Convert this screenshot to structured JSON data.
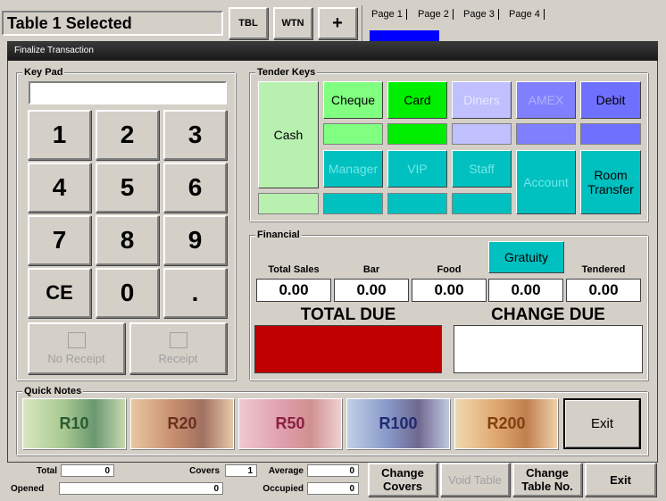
{
  "header": {
    "table_title": "Table 1 Selected",
    "tbl_label": "TBL",
    "wtn_label": "WTN",
    "plus_label": "+",
    "pages": [
      "Page 1",
      "Page 2",
      "Page 3",
      "Page 4"
    ]
  },
  "dialog": {
    "title": "Finalize Transaction"
  },
  "keypad": {
    "label": "Key Pad",
    "display": "",
    "keys": [
      "1",
      "2",
      "3",
      "4",
      "5",
      "6",
      "7",
      "8",
      "9",
      "CE",
      "0",
      "."
    ],
    "no_receipt": "No Receipt",
    "receipt": "Receipt"
  },
  "tender": {
    "label": "Tender Keys",
    "cash": "Cash",
    "cheque": "Cheque",
    "card": "Card",
    "diners": "Diners",
    "amex": "AMEX",
    "debit": "Debit",
    "manager": "Manager",
    "vip": "VIP",
    "staff": "Staff",
    "account": "Account",
    "room_transfer": "Room Transfer"
  },
  "financial": {
    "label": "Financial",
    "gratuity": "Gratuity",
    "total_sales_label": "Total Sales",
    "total_sales": "0.00",
    "bar_label": "Bar",
    "bar": "0.00",
    "food_label": "Food",
    "food": "0.00",
    "gratuity_value": "0.00",
    "tendered_label": "Tendered",
    "tendered": "0.00",
    "total_due_label": "TOTAL DUE",
    "change_due_label": "CHANGE DUE"
  },
  "quick_notes": {
    "label": "Quick Notes",
    "notes": [
      "R10",
      "R20",
      "R50",
      "R100",
      "R200"
    ],
    "exit": "Exit"
  },
  "statusbar": {
    "total_label": "Total",
    "total_value": "0",
    "covers_label": "Covers",
    "covers_value": "1",
    "average_label": "Average",
    "average_value": "0",
    "opened_label": "Opened",
    "opened_value": "0",
    "occupied_label": "Occupied",
    "occupied_value": "0"
  },
  "bottom_buttons": {
    "change_covers": "Change Covers",
    "void_table": "Void Table",
    "change_table_no": "Change Table No.",
    "exit": "Exit"
  },
  "colors": {
    "cash": "#b8f0b0",
    "cheque": "#80ff80",
    "card": "#00ee00",
    "diners": "#c0c0ff",
    "amex": "#8080ff",
    "debit": "#7070ff",
    "teal": "#00c0c0",
    "total_due": "#c00000",
    "page_blue": "#0000ff"
  }
}
